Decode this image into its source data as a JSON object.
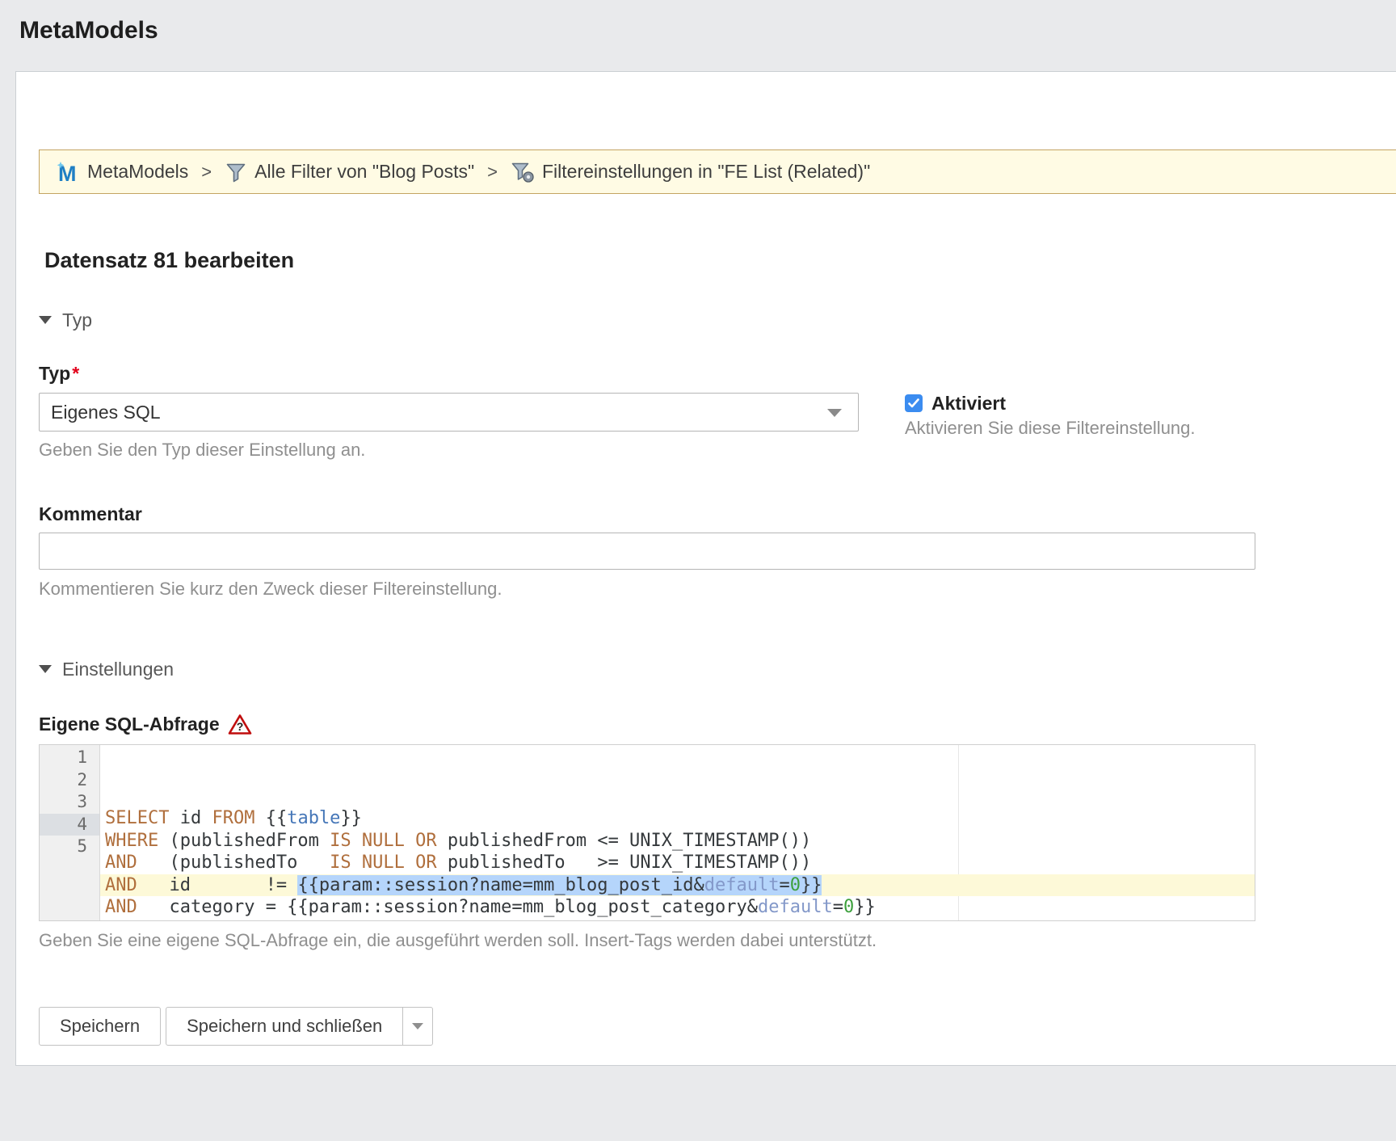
{
  "colors": {
    "accent_blue": "#3b8cf0",
    "breadcrumb_bg": "#fffbe4",
    "breadcrumb_border": "#c4a462",
    "keyword": "#b06f3d",
    "insert_tag_name": "#4677b8",
    "default_param": "#8398c9",
    "number_literal": "#3da03d",
    "selection": "#b5d5fb",
    "active_line": "#fdf9d8",
    "required_red": "#e2001a"
  },
  "page": {
    "title": "MetaModels"
  },
  "breadcrumb": {
    "separator": ">",
    "items": [
      {
        "icon": "metamodels-logo",
        "label": "MetaModels"
      },
      {
        "icon": "filter",
        "label": "Alle Filter von \"Blog Posts\""
      },
      {
        "icon": "filter-setting",
        "label": "Filtereinstellungen in \"FE List (Related)\""
      }
    ]
  },
  "form": {
    "heading": "Datensatz 81 bearbeiten",
    "section_typ": "Typ",
    "section_einstellungen": "Einstellungen",
    "typ": {
      "label": "Typ",
      "required": "*",
      "value": "Eigenes SQL",
      "help": "Geben Sie den Typ dieser Einstellung an."
    },
    "aktiviert": {
      "label": "Aktiviert",
      "checked": true,
      "help": "Aktivieren Sie diese Filtereinstellung."
    },
    "kommentar": {
      "label": "Kommentar",
      "value": "",
      "help": "Kommentieren Sie kurz den Zweck dieser Filtereinstellung."
    },
    "sql": {
      "label": "Eigene SQL-Abfrage",
      "help": "Geben Sie eine eigene SQL-Abfrage ein, die ausgeführt werden soll. Insert-Tags werden dabei unterstützt."
    }
  },
  "editor": {
    "print_margin_column": 80,
    "lines": [
      {
        "num": 1,
        "tokens": [
          [
            "SELECT",
            "kw"
          ],
          [
            " id ",
            "pl"
          ],
          [
            "FROM",
            "kw"
          ],
          [
            " {{",
            "pl"
          ],
          [
            "table",
            "tag"
          ],
          [
            "}}",
            "pl"
          ]
        ]
      },
      {
        "num": 2,
        "tokens": [
          [
            "WHERE",
            "kw"
          ],
          [
            " (publishedFrom ",
            "pl"
          ],
          [
            "IS",
            "kw"
          ],
          [
            " ",
            "pl"
          ],
          [
            "NULL",
            "kw"
          ],
          [
            " ",
            "pl"
          ],
          [
            "OR",
            "kw"
          ],
          [
            " publishedFrom <= UNIX_TIMESTAMP())",
            "pl"
          ]
        ]
      },
      {
        "num": 3,
        "tokens": [
          [
            "AND",
            "kw"
          ],
          [
            "   (publishedTo   ",
            "pl"
          ],
          [
            "IS",
            "kw"
          ],
          [
            " ",
            "pl"
          ],
          [
            "NULL",
            "kw"
          ],
          [
            " ",
            "pl"
          ],
          [
            "OR",
            "kw"
          ],
          [
            " publishedTo   >= UNIX_TIMESTAMP())",
            "pl"
          ]
        ]
      },
      {
        "num": 4,
        "active": true,
        "tokens": [
          [
            "AND",
            "kw"
          ],
          [
            "   id       != ",
            "pl"
          ],
          [
            "{{param::session?name=mm_blog_post_id&",
            "pl",
            "sel"
          ],
          [
            "default",
            "def",
            "sel"
          ],
          [
            "=",
            "pl",
            "sel"
          ],
          [
            "0",
            "num",
            "sel"
          ],
          [
            "}}",
            "pl",
            "sel"
          ]
        ]
      },
      {
        "num": 5,
        "tokens": [
          [
            "AND",
            "kw"
          ],
          [
            "   category = ",
            "pl"
          ],
          [
            "{{param::session?name=mm_blog_post_category&",
            "pl"
          ],
          [
            "default",
            "def"
          ],
          [
            "=",
            "pl"
          ],
          [
            "0",
            "num"
          ],
          [
            "}}",
            "pl"
          ]
        ]
      }
    ]
  },
  "buttons": {
    "save": "Speichern",
    "save_close": "Speichern und schließen"
  }
}
